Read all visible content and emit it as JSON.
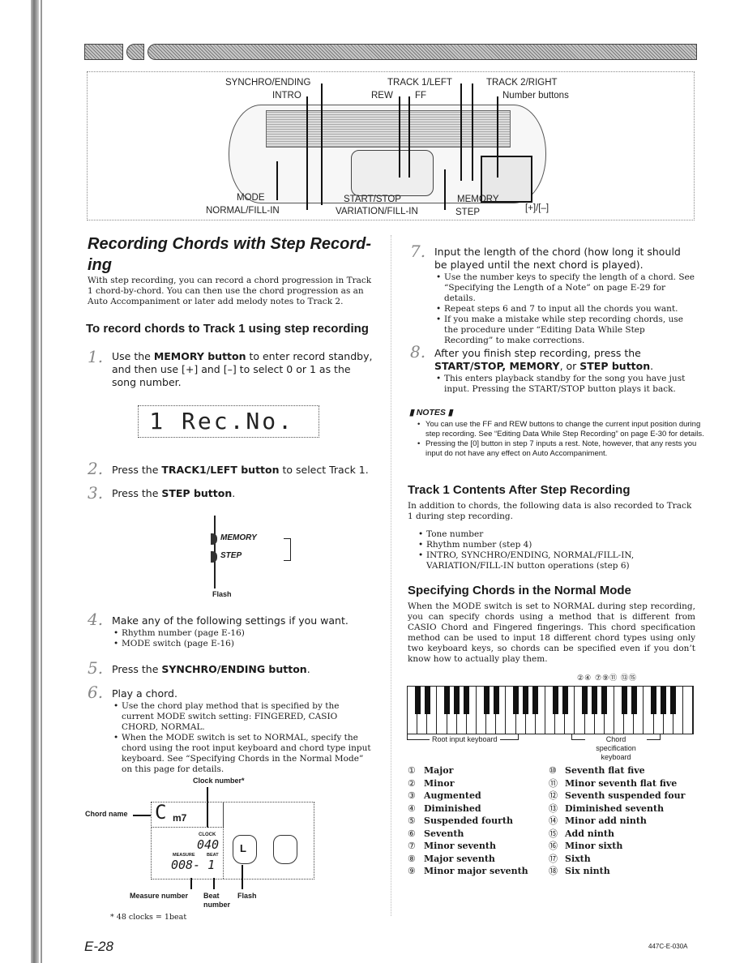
{
  "page": {
    "page_number": "E-28",
    "doc_code": "447C-E-030A"
  },
  "panel_callouts": {
    "synchro_ending": "SYNCHRO/ENDING",
    "intro": "INTRO",
    "track1_left": "TRACK 1/LEFT",
    "track2_right": "TRACK 2/RIGHT",
    "rew": "REW",
    "ff": "FF",
    "number_buttons": "Number buttons",
    "mode": "MODE",
    "normal_fill_in": "NORMAL/FILL-IN",
    "start_stop": "START/STOP",
    "variation_fill_in": "VARIATION/FILL-IN",
    "memory": "MEMORY",
    "step": "STEP",
    "plus_minus": "[+]/[–]"
  },
  "left": {
    "title": "Recording Chords with Step Record-ing",
    "intro": "With step recording, you can record a chord progression in Track 1 chord-by-chord. You can then use the chord progression as an Auto Accompaniment or later add melody notes to Track 2.",
    "subheading": "To record chords to Track 1 using step recording",
    "step1_num": "1.",
    "step1_pre": "Use the ",
    "step1_bold": "MEMORY button",
    "step1_post": " to enter record standby, and then use [+] and [–] to select 0 or 1 as the song number.",
    "lcd_text": "1 Rec.No.",
    "step2_num": "2.",
    "step2_pre": "Press the ",
    "step2_bold": "TRACK1/LEFT button",
    "step2_post": " to select Track 1.",
    "step3_num": "3.",
    "step3_pre": "Press the ",
    "step3_bold": "STEP button",
    "step3_post": ".",
    "fig_memory": "MEMORY",
    "fig_step": "STEP",
    "fig_flash": "Flash",
    "step4_num": "4.",
    "step4_text": "Make any of the following settings if you want.",
    "step4_bullets": [
      "Rhythm number (page E-16)",
      "MODE switch (page E-16)"
    ],
    "step5_num": "5.",
    "step5_pre": "Press the ",
    "step5_bold": "SYNCHRO/ENDING button",
    "step5_post": ".",
    "step6_num": "6.",
    "step6_text": "Play a chord.",
    "step6_bullets": [
      "Use the chord play method that is specified by the current MODE switch setting: FINGERED, CASIO CHORD, NORMAL.",
      "When the MODE switch is set to NORMAL, specify the chord using the root input keyboard and chord type input keyboard. See “Specifying Chords in the Normal Mode” on this page for details."
    ],
    "display_fig": {
      "clock_number_label": "Clock number*",
      "chord_name_label": "Chord name",
      "chord_root": "C",
      "chord_type": "m7",
      "clock_caption": "CLOCK",
      "clock_value": "040",
      "measure_caption": "MEASURE",
      "beat_caption": "BEAT",
      "measure_beat_value": "008- 1",
      "hand_letter": "L",
      "measure_number_label": "Measure number",
      "beat_number_label": "Beat number",
      "flash_label": "Flash",
      "footnote": "* 48 clocks = 1beat"
    }
  },
  "right": {
    "step7_num": "7.",
    "step7_text": "Input the length of the chord (how long it should be played until the next chord is played).",
    "step7_bullets": [
      "Use the number keys to specify the length of a chord. See “Specifying the Length of a Note” on page E-29 for details.",
      "Repeat steps 6 and 7 to input all the chords you want.",
      "If you make a mistake while step recording chords, use the procedure under “Editing Data While Step Recording” to make corrections."
    ],
    "step8_num": "8.",
    "step8_pre": "After you finish step recording, press the ",
    "step8_bold1": "START/STOP, MEMORY",
    "step8_mid": ", or ",
    "step8_bold2": "STEP button",
    "step8_post": ".",
    "step8_bullets": [
      "This enters playback standby for the song you have just input. Pressing the START/STOP button plays it back."
    ],
    "notes_heading": "NOTES",
    "notes": [
      "You can use the FF and REW buttons to change the current input position during step recording. See “Editing Data While Step Recording” on page E-30 for details.",
      "Pressing the [0] button in step 7 inputs a rest. Note, however, that any rests you input do not have any effect on Auto Accompaniment."
    ],
    "track1_heading": "Track 1 Contents After Step Recording",
    "track1_intro": "In addition to chords, the following data is also recorded to Track 1 during step recording.",
    "track1_bullets": [
      "Tone number",
      "Rhythm number (step 4)",
      "INTRO, SYNCHRO/ENDING, NORMAL/FILL-IN, VARIATION/FILL-IN button operations (step 6)"
    ],
    "normal_heading": "Specifying Chords in the Normal Mode",
    "normal_text": "When the MODE switch is set to NORMAL during step recording, you can specify chords using a method that is different from CASIO Chord and Fingered fingerings. This chord specification method can be used to input 18 different chord types using only two keyboard keys, so chords can be specified even if you don’t know how to actually play them.",
    "keyboard_labels": {
      "root": "Root input keyboard",
      "chord_spec": "Chord specification keyboard",
      "top_marks": "②④  ⑦⑨⑪  ⑬⑮"
    },
    "chord_types_col1": [
      {
        "n": "①",
        "label": "Major"
      },
      {
        "n": "②",
        "label": "Minor"
      },
      {
        "n": "③",
        "label": "Augmented"
      },
      {
        "n": "④",
        "label": "Diminished"
      },
      {
        "n": "⑤",
        "label": "Suspended fourth"
      },
      {
        "n": "⑥",
        "label": "Seventh"
      },
      {
        "n": "⑦",
        "label": "Minor seventh"
      },
      {
        "n": "⑧",
        "label": "Major seventh"
      },
      {
        "n": "⑨",
        "label": "Minor major seventh"
      }
    ],
    "chord_types_col2": [
      {
        "n": "⑩",
        "label": "Seventh flat five"
      },
      {
        "n": "⑪",
        "label": "Minor seventh flat five"
      },
      {
        "n": "⑫",
        "label": "Seventh suspended four"
      },
      {
        "n": "⑬",
        "label": "Diminished seventh"
      },
      {
        "n": "⑭",
        "label": "Minor add ninth"
      },
      {
        "n": "⑮",
        "label": "Add ninth"
      },
      {
        "n": "⑯",
        "label": "Minor sixth"
      },
      {
        "n": "⑰",
        "label": "Sixth"
      },
      {
        "n": "⑱",
        "label": "Six ninth"
      }
    ]
  }
}
